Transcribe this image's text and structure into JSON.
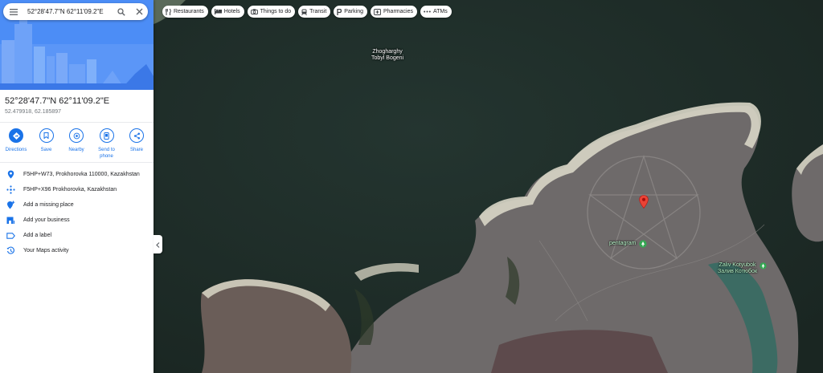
{
  "search": {
    "query": "52°28'47.7\"N 62°11'09.2\"E"
  },
  "place": {
    "title": "52°28'47.7\"N 62°11'09.2\"E",
    "coords": "52.479918, 62.185897"
  },
  "actions": [
    {
      "label": "Directions",
      "icon": "directions-icon"
    },
    {
      "label": "Save",
      "icon": "bookmark-icon"
    },
    {
      "label": "Nearby",
      "icon": "nearby-icon"
    },
    {
      "label": "Send to\nphone",
      "icon": "phone-icon"
    },
    {
      "label": "Share",
      "icon": "share-icon"
    }
  ],
  "rows": [
    {
      "text": "F5HP+W73, Prokhorovka 110000, Kazakhstan",
      "icon": "location-pin-icon"
    },
    {
      "text": "F5HP+X96 Prokhorovka, Kazakhstan",
      "icon": "plus-code-icon"
    },
    {
      "text": "Add a missing place",
      "icon": "add-place-icon"
    },
    {
      "text": "Add your business",
      "icon": "business-icon"
    },
    {
      "text": "Add a label",
      "icon": "label-icon"
    },
    {
      "text": "Your Maps activity",
      "icon": "history-icon"
    }
  ],
  "chips": [
    {
      "label": "Restaurants",
      "icon": "restaurant-icon"
    },
    {
      "label": "Hotels",
      "icon": "hotel-icon"
    },
    {
      "label": "Things to do",
      "icon": "camera-icon"
    },
    {
      "label": "Transit",
      "icon": "transit-icon"
    },
    {
      "label": "Parking",
      "icon": "parking-icon"
    },
    {
      "label": "Pharmacies",
      "icon": "pharmacy-icon"
    },
    {
      "label": "ATMs",
      "icon": "more-icon"
    }
  ],
  "map_labels": {
    "reservoir_line1": "Zhogharghy",
    "reservoir_line2": "Tobyl Bogeni",
    "pentagram": "pentagram",
    "bay_line1": "Zaliv Kotyubok",
    "bay_line2": "Залив Котюбок"
  },
  "colors": {
    "accent": "#1a73e8",
    "pin": "#ea4335",
    "poi": "#34a853"
  }
}
